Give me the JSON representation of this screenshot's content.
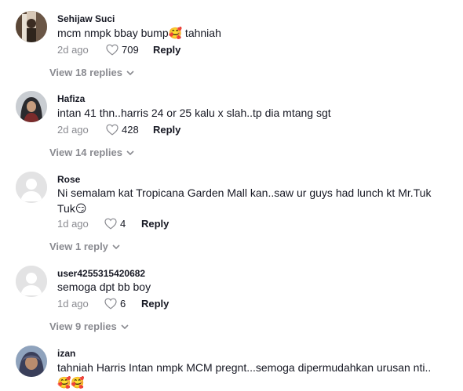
{
  "comments": [
    {
      "username": "Sehijaw Suci",
      "text": "mcm nmpk bbay bump",
      "text_after": " tahniah",
      "emoji": "🥰",
      "date": "2d ago",
      "likes": "709",
      "reply_label": "Reply",
      "view_replies": "View 18 replies",
      "avatar": "photo-avatar"
    },
    {
      "username": "Hafiza",
      "text": "intan 41 thn..harris 24 or 25 kalu x slah..tp dia mtang sgt",
      "date": "2d ago",
      "likes": "428",
      "reply_label": "Reply",
      "view_replies": "View 14 replies",
      "avatar": "photo-avatar"
    },
    {
      "username": "Rose",
      "text_line1": "Ni semalam kat Tropicana Garden Mall kan..saw ur guys had lunch kt Mr.Tuk",
      "text_line2": "Tuk",
      "emoji": "😏",
      "date": "1d ago",
      "likes": "4",
      "reply_label": "Reply",
      "view_replies": "View 1 reply",
      "avatar": "default-avatar"
    },
    {
      "username": "user4255315420682",
      "text": "semoga dpt bb boy",
      "date": "1d ago",
      "likes": "6",
      "reply_label": "Reply",
      "view_replies": "View 9 replies",
      "avatar": "default-avatar"
    },
    {
      "username": "izan",
      "text": "tahniah Harris Intan nmpk MCM pregnt...semoga dipermudahkan urusan nti..",
      "emoji_line": "🥰🥰",
      "avatar": "photo-avatar"
    }
  ],
  "icons": {
    "like": "heart-outline-icon",
    "expand": "chevron-down-icon"
  },
  "colors": {
    "text": "#161823",
    "muted": "#8a8b91",
    "avatar_bg": "#e3e3e4"
  }
}
